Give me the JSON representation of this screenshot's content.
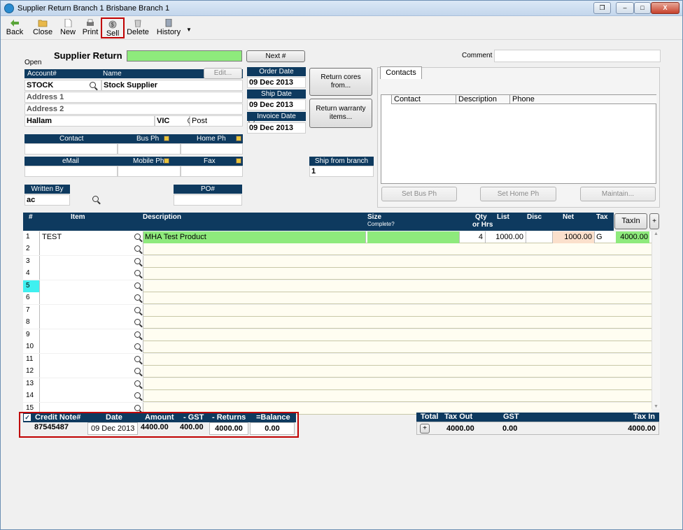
{
  "window": {
    "title": "Supplier Return  Branch 1  Brisbane Branch 1"
  },
  "toolbar": {
    "back": "Back",
    "close": "Close",
    "new": "New",
    "print": "Print",
    "sell": "Sell",
    "delete": "Delete",
    "history": "History"
  },
  "form": {
    "heading": "Supplier Return",
    "status": "Open",
    "next_button": "Next #",
    "comment_label": "Comment",
    "comment_value": "",
    "account_label": "Account#",
    "name_label": "Name",
    "edit_button": "Edit...",
    "account_value": "STOCK",
    "name_value": "Stock Supplier",
    "address1_label": "Address 1",
    "address2_label": "Address 2",
    "suburb_value": "Hallam",
    "state_value": "VIC",
    "post_label": "Post",
    "order_date_label": "Order Date",
    "order_date_value": "09 Dec 2013",
    "ship_date_label": "Ship Date",
    "ship_date_value": "09 Dec 2013",
    "invoice_date_label": "Invoice Date",
    "invoice_date_value": "09 Dec 2013",
    "return_cores_button": "Return cores from...",
    "return_warranty_button": "Return warranty items...",
    "contact_label": "Contact",
    "bus_ph_label": "Bus Ph",
    "home_ph_label": "Home Ph",
    "email_label": "eMail",
    "mobile_ph_label": "Mobile Ph",
    "fax_label": "Fax",
    "ship_from_branch_label": "Ship from branch",
    "ship_from_branch_value": "1",
    "written_by_label": "Written By",
    "written_by_value": "ac",
    "po_label": "PO#",
    "po_value": ""
  },
  "contacts": {
    "tab_label": "Contacts",
    "columns": [
      "Contact",
      "Description",
      "Phone"
    ],
    "set_bus_button": "Set Bus Ph",
    "set_home_button": "Set Home Ph",
    "maintain_button": "Maintain..."
  },
  "grid": {
    "columns": {
      "num": "#",
      "item": "Item",
      "description": "Description",
      "size": "Size",
      "size_sub": "Complete?",
      "qty": "Qty",
      "qty_sub": "or Hrs",
      "list": "List",
      "disc": "Disc",
      "net": "Net",
      "tax": "Tax"
    },
    "taxin_button": "TaxIn",
    "plus_button": "+",
    "row1": {
      "num": "1",
      "item": "TEST",
      "description": "MHA Test Product",
      "qty": "4",
      "list": "1000.00",
      "net": "1000.00",
      "tax": "G",
      "taxin": "4000.00"
    },
    "empty_rows": [
      "2",
      "3",
      "4",
      "5",
      "6",
      "7",
      "8",
      "9",
      "10",
      "11",
      "12",
      "13",
      "14",
      "15"
    ]
  },
  "credit": {
    "checkbox_label": "✓",
    "note_label": "Credit Note#",
    "date_label": "Date",
    "amount_label": "Amount",
    "gst_label": "- GST",
    "returns_label": "- Returns",
    "balance_label": "=Balance",
    "note_value": "87545487",
    "date_value": "09 Dec 2013",
    "amount_value": "4400.00",
    "gst_value": "400.00",
    "returns_value": "4000.00",
    "balance_value": "0.00"
  },
  "totals": {
    "total_label": "Total",
    "taxout_label": "Tax Out",
    "gst_label": "GST",
    "taxin_label": "Tax In",
    "plus_button": "+",
    "taxout_value": "4000.00",
    "gst_value": "0.00",
    "taxin_value": "4000.00"
  }
}
